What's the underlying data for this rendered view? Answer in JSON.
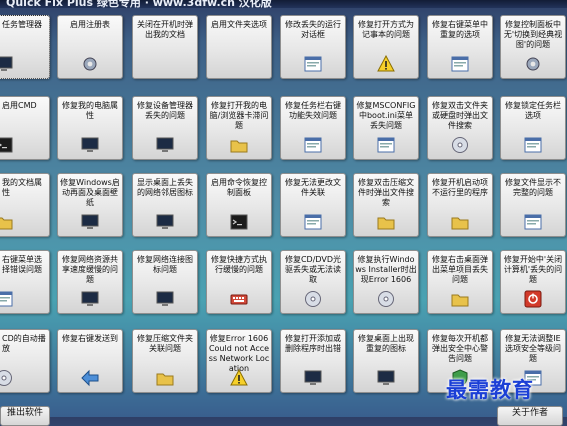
{
  "window": {
    "title": "Quick Fix Plus 绿色专用 · www.3dfw.cn 汉化版"
  },
  "colors": {
    "background": "#4f8ca6",
    "tile": "#e7e7e7",
    "watermark": "#1b3fd6"
  },
  "rows": [
    [
      {
        "label": "任务管理器",
        "icon": "task-manager-icon"
      },
      {
        "label": "启用注册表",
        "icon": "registry-icon"
      },
      {
        "label": "关闭在开机时弹出我的文档",
        "icon": ""
      },
      {
        "label": "启用文件夹选项",
        "icon": ""
      },
      {
        "label": "修改丢失的运行对话框",
        "icon": "run-dialog-icon"
      },
      {
        "label": "修复打开方式为记事本的问题",
        "icon": "warning-icon"
      },
      {
        "label": "修复右键菜单中重复的选项",
        "icon": "context-menu-icon"
      },
      {
        "label": "修复控制面板中无'切换到经典视图'的问题",
        "icon": "control-panel-icon"
      }
    ],
    [
      {
        "label": "启用CMD",
        "icon": "cmd-icon"
      },
      {
        "label": "修复我的电脑属性",
        "icon": "computer-icon"
      },
      {
        "label": "修复设备管理器丢失的问题",
        "icon": "device-manager-icon"
      },
      {
        "label": "修复打开我的电脑/浏览器卡滞问题",
        "icon": "folder-icon"
      },
      {
        "label": "修复任务栏右键功能失效问题",
        "icon": "taskbar-icon"
      },
      {
        "label": "修复MSCONFIG中boot.ini菜单丢失问题",
        "icon": "msconfig-icon"
      },
      {
        "label": "修复双击文件夹或硬盘时弹出文件搜索",
        "icon": "drive-icon"
      },
      {
        "label": "修复锁定任务栏选项",
        "icon": "lock-icon"
      }
    ],
    [
      {
        "label": "我的文档属性",
        "icon": "document-icon"
      },
      {
        "label": "修复Windows启动再面及桌面壁纸",
        "icon": "wallpaper-icon"
      },
      {
        "label": "显示桌面上丢失的网络邻居图标",
        "icon": "network-icon"
      },
      {
        "label": "启用命令恢复控制面板",
        "icon": "console-icon"
      },
      {
        "label": "修复无法更改文件关联",
        "icon": "file-association-icon"
      },
      {
        "label": "修复双击压缩文件时弹出文件搜索",
        "icon": "zip-icon"
      },
      {
        "label": "修复开机启动项不运行里的程序",
        "icon": "startup-icon"
      },
      {
        "label": "修复文件显示不完整的问题",
        "icon": "file-icon"
      }
    ],
    [
      {
        "label": "右键菜单选择错误问题",
        "icon": "right-click-icon"
      },
      {
        "label": "修复网络资源共享速度缓慢的问题",
        "icon": "share-icon"
      },
      {
        "label": "修复网络连接图标问题",
        "icon": "network-connection-icon"
      },
      {
        "label": "修复快捷方式执行缓慢的问题",
        "icon": "keyboard-icon"
      },
      {
        "label": "修复CD/DVD光驱丢失或无法读取",
        "icon": "cd-drive-icon"
      },
      {
        "label": "修复执行Windows Installer时出现Error 1606",
        "icon": "installer-icon"
      },
      {
        "label": "修复右击桌面弹出菜单项目丢失问题",
        "icon": "desktop-menu-icon"
      },
      {
        "label": "修复开始中'关闭计算机'丢失的问题",
        "icon": "power-icon"
      }
    ],
    [
      {
        "label": "CD的自动播放",
        "icon": "cd-autoplay-icon"
      },
      {
        "label": "修复右键发送到",
        "icon": "arrow-left-icon"
      },
      {
        "label": "修复压缩文件夹关联问题",
        "icon": "zip-folder-icon"
      },
      {
        "label": "修复Error 1606 Could not Access Network Location",
        "icon": "network-error-icon"
      },
      {
        "label": "修复打开添加或删除程序时出错",
        "icon": "add-remove-icon"
      },
      {
        "label": "修复桌面上出现重复的图标",
        "icon": "desktop-icon"
      },
      {
        "label": "修复每次开机都弹出安全中心警告问题",
        "icon": "shield-icon"
      },
      {
        "label": "修复无法调整IE选项安全等级问题",
        "icon": "ie-security-icon"
      }
    ]
  ],
  "bottom": {
    "left_label": "推出软件",
    "right_label": "关于作者"
  },
  "watermark": "最需教育"
}
